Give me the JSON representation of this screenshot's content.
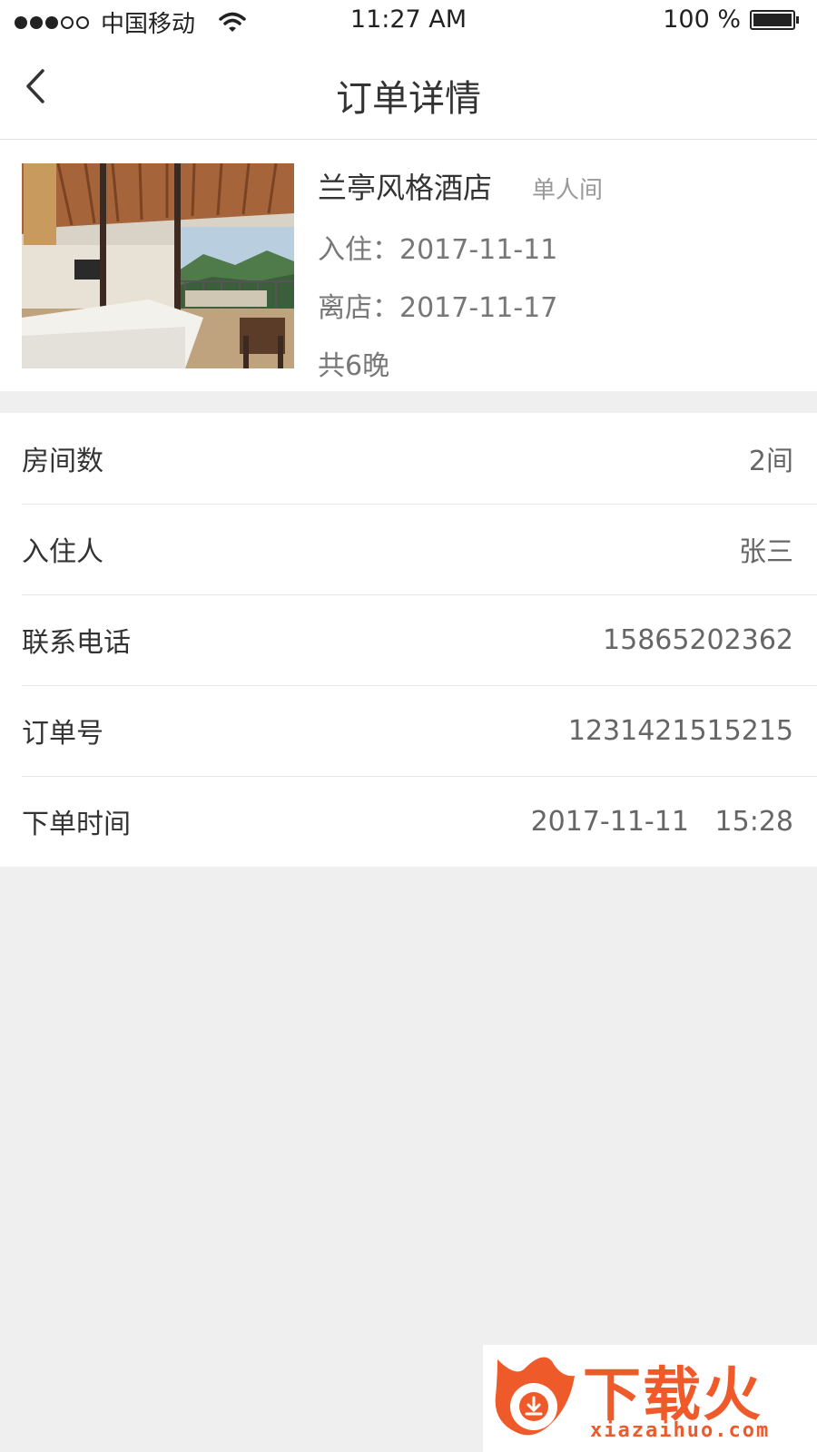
{
  "status_bar": {
    "carrier": "中国移动",
    "time": "11:27 AM",
    "battery": "100 %",
    "signal_strength": 3,
    "signal_max": 5
  },
  "nav": {
    "title": "订单详情",
    "back_icon": "chevron-left-icon"
  },
  "hotel": {
    "name": "兰亭风格酒店",
    "room_type": "单人间",
    "checkin": "入住：2017-11-11",
    "checkout": "离店：2017-11-17",
    "nights": "共6晚"
  },
  "details": [
    {
      "label": "房间数",
      "value": "2间"
    },
    {
      "label": "入住人",
      "value": "张三"
    },
    {
      "label": "联系电话",
      "value": "15865202362"
    },
    {
      "label": "订单号",
      "value": "1231421515215"
    },
    {
      "label": "下单时间",
      "value": "2017-11-11   15:28"
    }
  ],
  "watermark": {
    "brand": "下载火",
    "url": "xiazaihuo.com"
  },
  "colors": {
    "background": "#efefef",
    "card": "#ffffff",
    "primary_text": "#333333",
    "secondary_text": "#777777",
    "watermark": "#ef5a2a"
  }
}
